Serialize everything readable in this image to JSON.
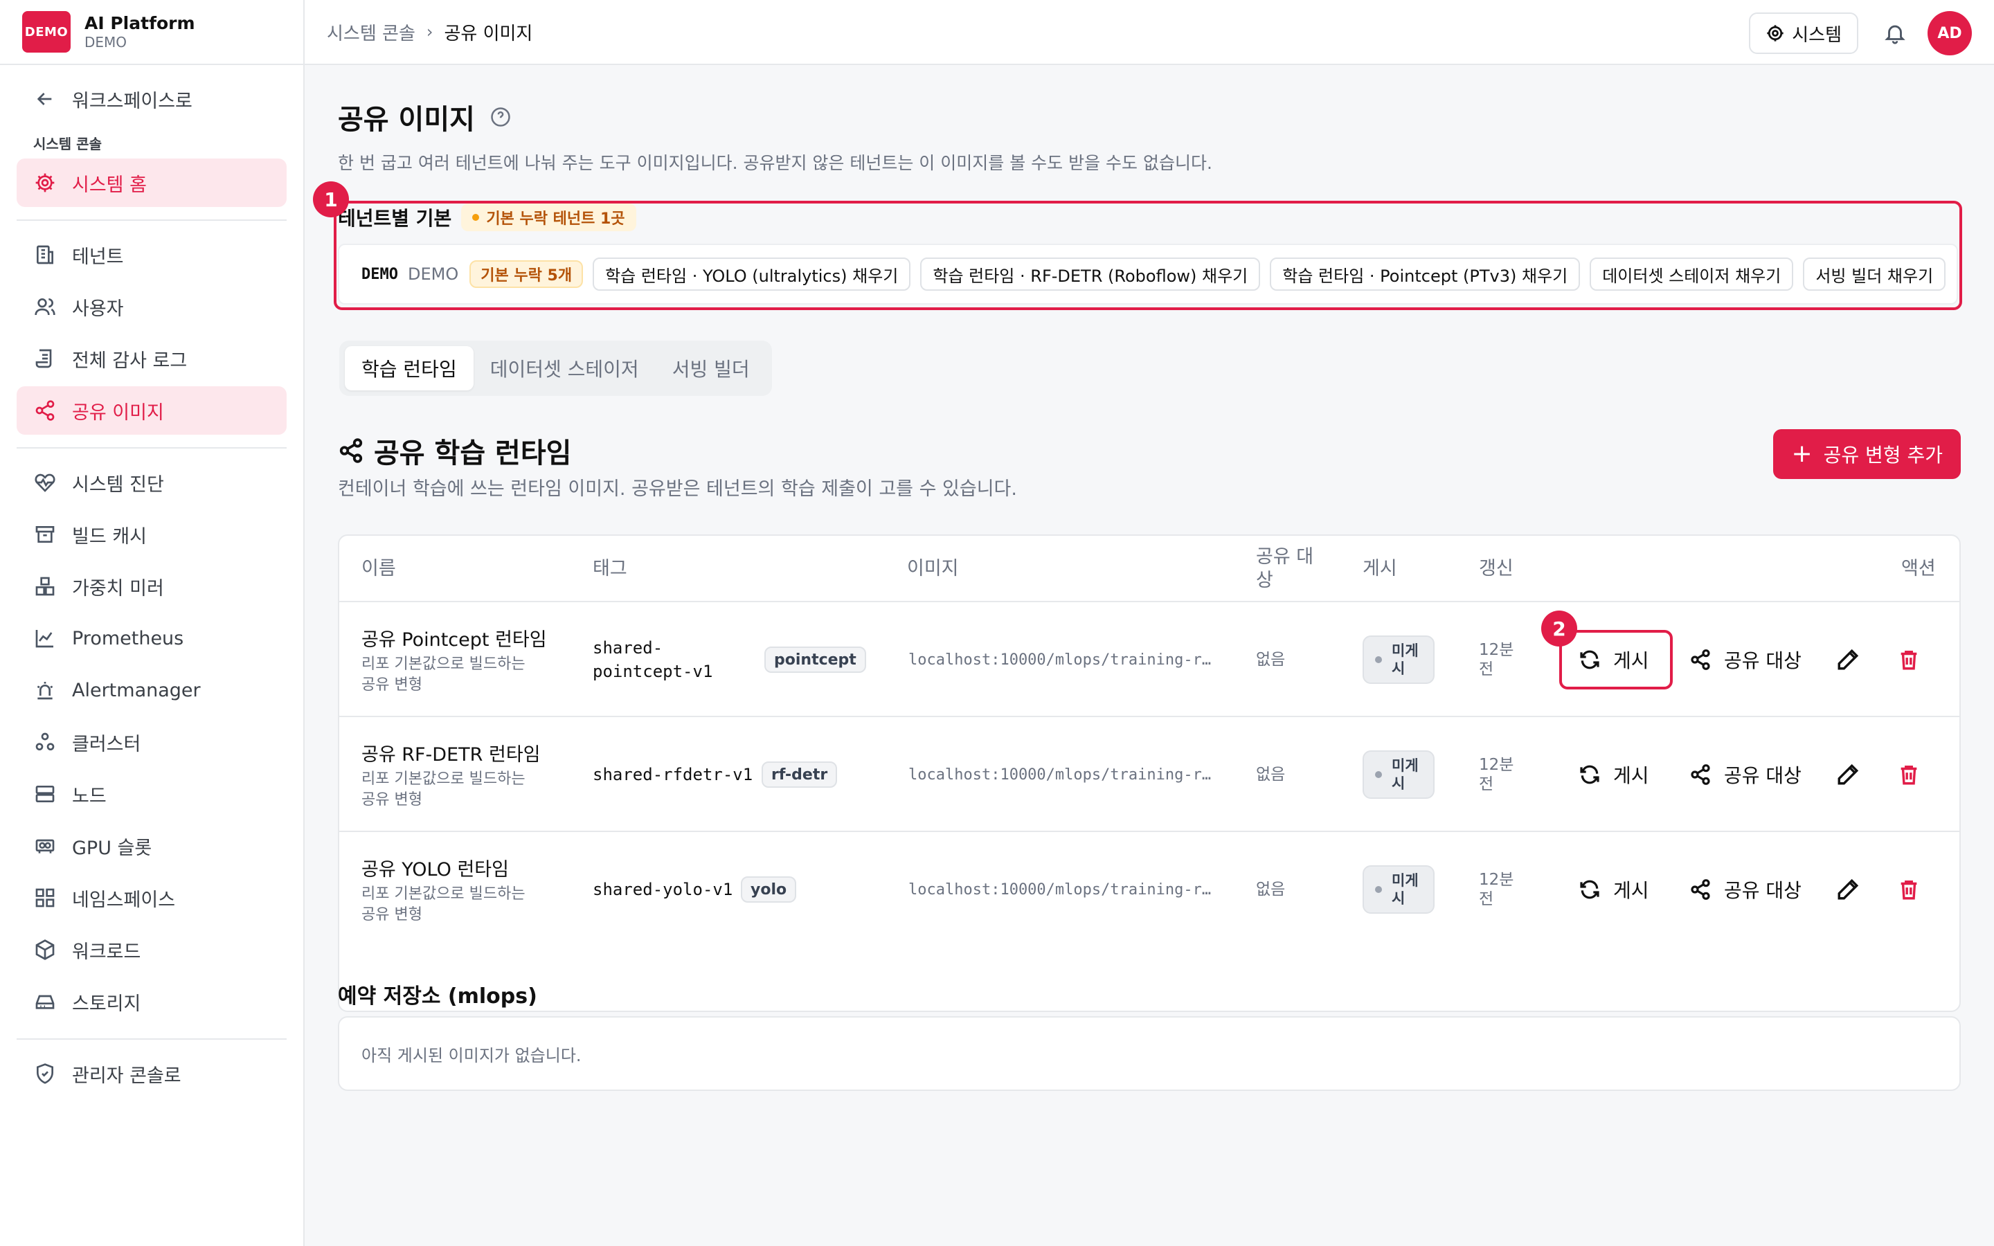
{
  "brand": {
    "logo": "DEMO",
    "name": "AI Platform",
    "sub": "DEMO"
  },
  "sidebar": {
    "back_label": "워크스페이스로",
    "section_label": "시스템 콘솔",
    "home_label": "시스템 홈",
    "items": [
      {
        "label": "테넌트",
        "icon": "building-icon"
      },
      {
        "label": "사용자",
        "icon": "users-icon"
      },
      {
        "label": "전체 감사 로그",
        "icon": "scroll-icon"
      },
      {
        "label": "공유 이미지",
        "icon": "share-icon",
        "active": true
      }
    ],
    "items2": [
      {
        "label": "시스템 진단",
        "icon": "heart-pulse-icon"
      },
      {
        "label": "빌드 캐시",
        "icon": "archive-icon"
      },
      {
        "label": "가중치 미러",
        "icon": "boxes-icon"
      },
      {
        "label": "Prometheus",
        "icon": "chart-icon"
      },
      {
        "label": "Alertmanager",
        "icon": "siren-icon"
      },
      {
        "label": "클러스터",
        "icon": "cluster-icon"
      },
      {
        "label": "노드",
        "icon": "server-icon"
      },
      {
        "label": "GPU 슬롯",
        "icon": "gpu-icon"
      },
      {
        "label": "네임스페이스",
        "icon": "grid-icon"
      },
      {
        "label": "워크로드",
        "icon": "package-icon"
      },
      {
        "label": "스토리지",
        "icon": "drive-icon"
      }
    ],
    "admin_label": "관리자 콘솔로"
  },
  "topbar": {
    "crumb_root": "시스템 콘솔",
    "crumb_current": "공유 이미지",
    "system_button": "시스템",
    "avatar": "AD"
  },
  "page": {
    "title": "공유 이미지",
    "description": "한 번 굽고 여러 테넌트에 나눠 주는 도구 이미지입니다. 공유받지 않은 테넌트는 이 이미지를 볼 수도 받을 수도 없습니다."
  },
  "tenant_defaults": {
    "marker": "1",
    "title": "테넌트별 기본",
    "warning": "기본 누락 테넌트 1곳",
    "code": "DEMO",
    "name": "DEMO",
    "missing": "기본 누락 5개",
    "chips": [
      "학습 런타임 · YOLO (ultralytics) 채우기",
      "학습 런타임 · RF-DETR (Roboflow) 채우기",
      "학습 런타임 · Pointcept (PTv3) 채우기",
      "데이터셋 스테이저 채우기",
      "서빙 빌더 채우기"
    ]
  },
  "tabs": [
    "학습 런타임",
    "데이터셋 스테이저",
    "서빙 빌더"
  ],
  "section": {
    "title": "공유 학습 런타임",
    "description": "컨테이너 학습에 쓰는 런타임 이미지. 공유받은 테넌트의 학습 제출이 고를 수 있습니다.",
    "add_button": "공유 변형 추가"
  },
  "table": {
    "headers": {
      "name": "이름",
      "tag": "태그",
      "image": "이미지",
      "share1": "공유 대",
      "share2": "상",
      "publish": "게시",
      "updated": "갱신",
      "actions": "액션"
    },
    "rows": [
      {
        "name": "공유 Pointcept 런타임",
        "sub": "리포 기본값으로 빌드하는 공유 변형",
        "tag1": "shared-",
        "tag2": "pointcept-v1",
        "pill": "pointcept",
        "image": "localhost:10000/mlops/training-r…",
        "share": "없음",
        "pub1": "미게",
        "pub2": "시",
        "upd1": "12분",
        "upd2": "전",
        "publish_btn": "게시",
        "share_btn": "공유 대상"
      },
      {
        "name": "공유 RF-DETR 런타임",
        "sub": "리포 기본값으로 빌드하는 공유 변형",
        "tag1": "shared-rfdetr-v1",
        "tag2": "",
        "pill": "rf-detr",
        "image": "localhost:10000/mlops/training-r…",
        "share": "없음",
        "pub1": "미게",
        "pub2": "시",
        "upd1": "12분",
        "upd2": "전",
        "publish_btn": "게시",
        "share_btn": "공유 대상"
      },
      {
        "name": "공유 YOLO 런타임",
        "sub": "리포 기본값으로 빌드하는 공유 변형",
        "tag1": "shared-yolo-v1",
        "tag2": "",
        "pill": "yolo",
        "image": "localhost:10000/mlops/training-r…",
        "share": "없음",
        "pub1": "미게",
        "pub2": "시",
        "upd1": "12분",
        "upd2": "전",
        "publish_btn": "게시",
        "share_btn": "공유 대상"
      }
    ],
    "marker": "2"
  },
  "reserved": {
    "title": "예약 저장소 (mlops)",
    "empty": "아직 게시된 이미지가 없습니다."
  },
  "colors": {
    "accent": "#e11d48",
    "accent_soft": "#fde7ec",
    "warn_bg": "#fff4dc",
    "warn_text": "#b45309"
  }
}
